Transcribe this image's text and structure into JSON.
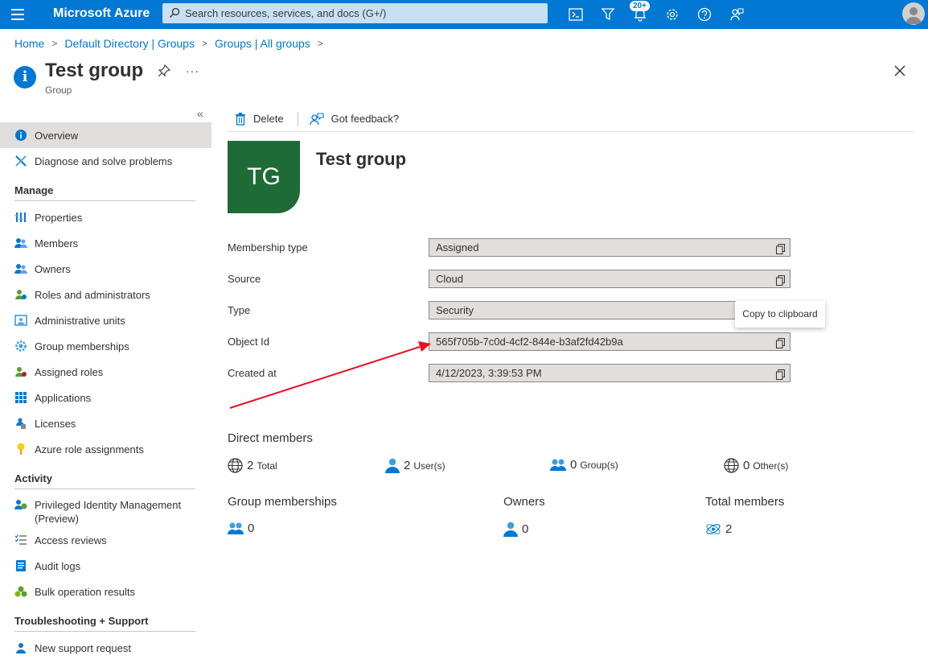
{
  "topbar": {
    "brand": "Microsoft Azure",
    "search_placeholder": "Search resources, services, and docs (G+/)",
    "notifications_badge": "20+",
    "accent": "#0078d4"
  },
  "breadcrumb": [
    "Home",
    "Default Directory | Groups",
    "Groups | All groups"
  ],
  "header": {
    "title": "Test group",
    "subtitle": "Group"
  },
  "sidebar": {
    "items_top": [
      {
        "label": "Overview",
        "icon": "info-icon"
      },
      {
        "label": "Diagnose and solve problems",
        "icon": "wrench-icon"
      }
    ],
    "manage_heading": "Manage",
    "manage": [
      {
        "label": "Properties",
        "icon": "properties-icon"
      },
      {
        "label": "Members",
        "icon": "members-icon"
      },
      {
        "label": "Owners",
        "icon": "owners-icon"
      },
      {
        "label": "Roles and administrators",
        "icon": "roles-icon"
      },
      {
        "label": "Administrative units",
        "icon": "admin-units-icon"
      },
      {
        "label": "Group memberships",
        "icon": "gear-icon"
      },
      {
        "label": "Assigned roles",
        "icon": "assigned-roles-icon"
      },
      {
        "label": "Applications",
        "icon": "grid-icon"
      },
      {
        "label": "Licenses",
        "icon": "license-icon"
      },
      {
        "label": "Azure role assignments",
        "icon": "key-icon"
      }
    ],
    "activity_heading": "Activity",
    "activity": [
      {
        "label": "Privileged Identity Management (Preview)",
        "icon": "pim-icon"
      },
      {
        "label": "Access reviews",
        "icon": "checklist-icon"
      },
      {
        "label": "Audit logs",
        "icon": "log-icon"
      },
      {
        "label": "Bulk operation results",
        "icon": "bulk-icon"
      }
    ],
    "support_heading": "Troubleshooting + Support",
    "support": [
      {
        "label": "New support request",
        "icon": "support-icon"
      }
    ]
  },
  "commands": {
    "delete": "Delete",
    "feedback": "Got feedback?"
  },
  "group": {
    "initials": "TG",
    "name": "Test group",
    "avatar_color": "#1e6b35"
  },
  "properties": [
    {
      "label": "Membership type",
      "value": "Assigned"
    },
    {
      "label": "Source",
      "value": "Cloud"
    },
    {
      "label": "Type",
      "value": "Security"
    },
    {
      "label": "Object Id",
      "value": "565f705b-7c0d-4cf2-844e-b3af2fd42b9a"
    },
    {
      "label": "Created at",
      "value": "4/12/2023, 3:39:53 PM"
    }
  ],
  "tooltip": "Copy to clipboard",
  "direct_members": {
    "title": "Direct members",
    "total": {
      "count": "2",
      "label": "Total"
    },
    "users": {
      "count": "2",
      "label": "User(s)"
    },
    "groups": {
      "count": "0",
      "label": "Group(s)"
    },
    "others": {
      "count": "0",
      "label": "Other(s)"
    }
  },
  "summary": {
    "group_memberships": {
      "title": "Group memberships",
      "count": "0"
    },
    "owners": {
      "title": "Owners",
      "count": "0"
    },
    "total_members": {
      "title": "Total members",
      "count": "2"
    }
  },
  "annotation_color": "#e81123"
}
